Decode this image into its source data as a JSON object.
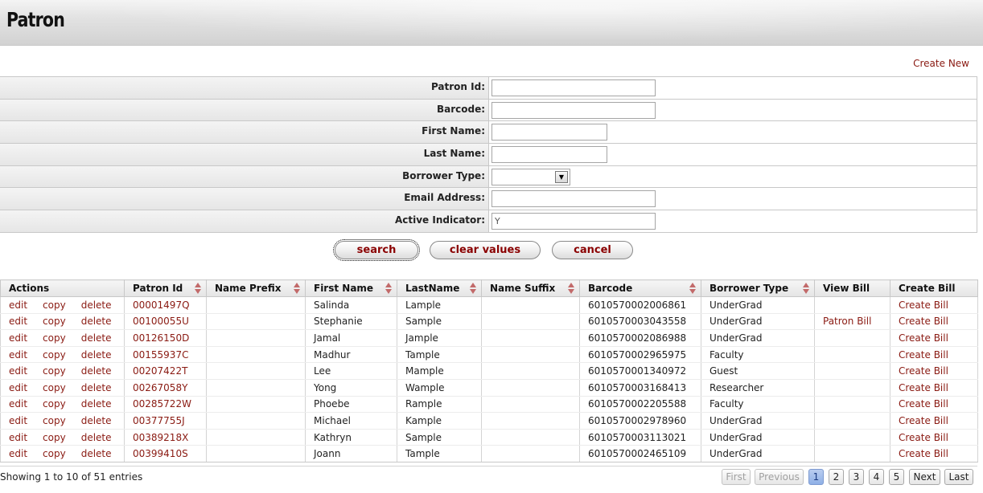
{
  "header": {
    "title": "Patron"
  },
  "create_new_label": "Create New",
  "criteria": {
    "patron_id": {
      "label": "Patron Id:",
      "value": ""
    },
    "barcode": {
      "label": "Barcode:",
      "value": ""
    },
    "first_name": {
      "label": "First Name:",
      "value": ""
    },
    "last_name": {
      "label": "Last Name:",
      "value": ""
    },
    "borrower_type": {
      "label": "Borrower Type:",
      "value": ""
    },
    "email_address": {
      "label": "Email Address:",
      "value": ""
    },
    "active_indicator": {
      "label": "Active Indicator:",
      "value": "Y"
    }
  },
  "buttons": {
    "search": "search",
    "clear": "clear values",
    "cancel": "cancel"
  },
  "table": {
    "columns": [
      "Actions",
      "Patron Id",
      "Name Prefix",
      "First Name",
      "LastName",
      "Name Suffix",
      "Barcode",
      "Borrower Type",
      "View Bill",
      "Create Bill"
    ],
    "action_labels": {
      "edit": "edit",
      "copy": "copy",
      "delete": "delete"
    },
    "rows": [
      {
        "patron_id": "00001497Q",
        "name_prefix": "",
        "first_name": "Salinda",
        "last_name": "Lample",
        "name_suffix": "",
        "barcode": "6010570002006861",
        "borrower_type": "UnderGrad",
        "view_bill": "",
        "create_bill": "Create Bill"
      },
      {
        "patron_id": "00100055U",
        "name_prefix": "",
        "first_name": "Stephanie",
        "last_name": "Sample",
        "name_suffix": "",
        "barcode": "6010570003043558",
        "borrower_type": "UnderGrad",
        "view_bill": "Patron Bill",
        "create_bill": "Create Bill"
      },
      {
        "patron_id": "00126150D",
        "name_prefix": "",
        "first_name": "Jamal",
        "last_name": "Jample",
        "name_suffix": "",
        "barcode": "6010570002086988",
        "borrower_type": "UnderGrad",
        "view_bill": "",
        "create_bill": "Create Bill"
      },
      {
        "patron_id": "00155937C",
        "name_prefix": "",
        "first_name": "Madhur",
        "last_name": "Tample",
        "name_suffix": "",
        "barcode": "6010570002965975",
        "borrower_type": "Faculty",
        "view_bill": "",
        "create_bill": "Create Bill"
      },
      {
        "patron_id": "00207422T",
        "name_prefix": "",
        "first_name": "Lee",
        "last_name": "Mample",
        "name_suffix": "",
        "barcode": "6010570001340972",
        "borrower_type": "Guest",
        "view_bill": "",
        "create_bill": "Create Bill"
      },
      {
        "patron_id": "00267058Y",
        "name_prefix": "",
        "first_name": "Yong",
        "last_name": "Wample",
        "name_suffix": "",
        "barcode": "6010570003168413",
        "borrower_type": "Researcher",
        "view_bill": "",
        "create_bill": "Create Bill"
      },
      {
        "patron_id": "00285722W",
        "name_prefix": "",
        "first_name": "Phoebe",
        "last_name": "Rample",
        "name_suffix": "",
        "barcode": "6010570002205588",
        "borrower_type": "Faculty",
        "view_bill": "",
        "create_bill": "Create Bill"
      },
      {
        "patron_id": "00377755J",
        "name_prefix": "",
        "first_name": "Michael",
        "last_name": "Kample",
        "name_suffix": "",
        "barcode": "6010570002978960",
        "borrower_type": "UnderGrad",
        "view_bill": "",
        "create_bill": "Create Bill"
      },
      {
        "patron_id": "00389218X",
        "name_prefix": "",
        "first_name": "Kathryn",
        "last_name": "Sample",
        "name_suffix": "",
        "barcode": "6010570003113021",
        "borrower_type": "UnderGrad",
        "view_bill": "",
        "create_bill": "Create Bill"
      },
      {
        "patron_id": "00399410S",
        "name_prefix": "",
        "first_name": "Joann",
        "last_name": "Tample",
        "name_suffix": "",
        "barcode": "6010570002465109",
        "borrower_type": "UnderGrad",
        "view_bill": "",
        "create_bill": "Create Bill"
      }
    ]
  },
  "footer": {
    "showing": "Showing 1 to 10 of 51 entries",
    "pager": {
      "first": "First",
      "previous": "Previous",
      "pages": [
        "1",
        "2",
        "3",
        "4",
        "5"
      ],
      "current_page": "1",
      "next": "Next",
      "last": "Last"
    }
  },
  "colors": {
    "link": "#8a1a12",
    "button_text": "#8a0000",
    "sort_arrow": "#c26a6a",
    "current_page": "#8fb0e6"
  },
  "icons": {
    "sort": "sort-arrows-icon",
    "dropdown": "dropdown-arrow-icon"
  }
}
